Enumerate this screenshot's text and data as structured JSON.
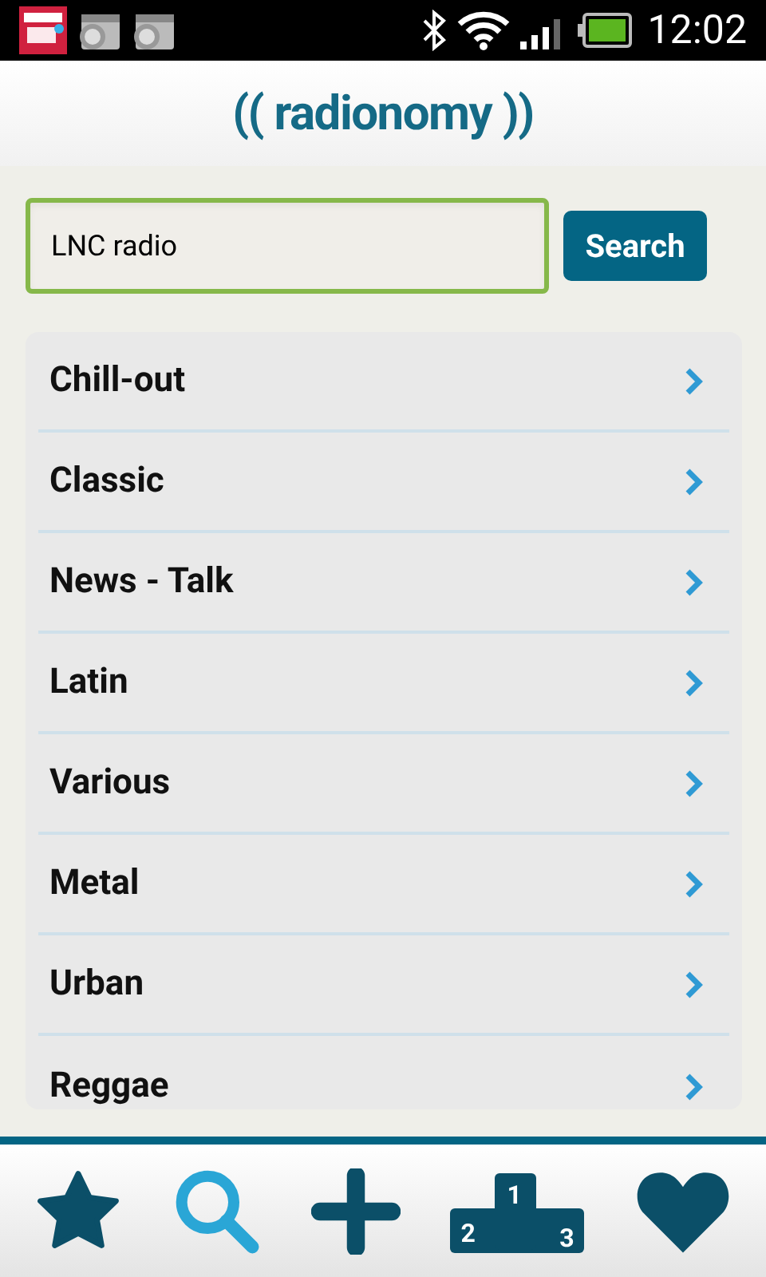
{
  "status_bar": {
    "time": "12:02"
  },
  "header": {
    "logo": "(( radionomy ))"
  },
  "search": {
    "value": "LNC radio",
    "focused": true,
    "button": "Search"
  },
  "genres": [
    {
      "label": "Chill-out"
    },
    {
      "label": "Classic"
    },
    {
      "label": "News - Talk"
    },
    {
      "label": "Latin"
    },
    {
      "label": "Various"
    },
    {
      "label": "Metal"
    },
    {
      "label": "Urban"
    },
    {
      "label": "Reggae"
    }
  ],
  "nav": [
    {
      "kind": "star",
      "selected": false
    },
    {
      "kind": "search",
      "selected": true
    },
    {
      "kind": "plus",
      "selected": false
    },
    {
      "kind": "podium",
      "selected": false,
      "labels": [
        "2",
        "1",
        "3"
      ]
    },
    {
      "kind": "heart",
      "selected": false
    }
  ]
}
